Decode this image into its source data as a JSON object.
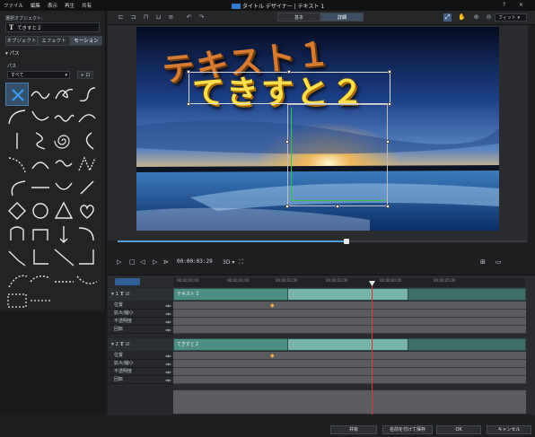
{
  "menu": [
    "ファイル",
    "編集",
    "表示",
    "再生",
    "共有"
  ],
  "app_title": "タイトル デザイナー",
  "doc_title": "テキスト 1",
  "window_controls": [
    "?",
    "×"
  ],
  "left": {
    "selected_object_label": "選択オブジェクト:",
    "selected_object_value": "てきすと２",
    "tabs": [
      "オブジェクト",
      "エフェクト",
      "モーション"
    ],
    "active_tab": "モーション",
    "section": "パス",
    "path_label": "パス",
    "path_select": "すべて",
    "path_add": "+ ロ"
  },
  "mode_tabs": [
    "基本",
    "詳細"
  ],
  "active_mode": "詳細",
  "zoom": "フィット",
  "canvas": {
    "title1": "テキスト１",
    "title2": "てきすと２"
  },
  "transport": {
    "timecode": "00:00:03:29",
    "mode": "3D ▾"
  },
  "ruler_ticks": [
    "00;00;00;00",
    "00;00;01;00",
    "00;00;02;00",
    "00;00;03;00",
    "00;00;04;00",
    "00;00;05;00"
  ],
  "tracks": [
    {
      "index": "1",
      "clip": "テキスト 1",
      "rows": [
        "位置",
        "拡大/縮小",
        "不透明度",
        "回転"
      ]
    },
    {
      "index": "2",
      "clip": "てきすと２",
      "rows": [
        "位置",
        "拡大/縮小",
        "不透明度",
        "回転"
      ]
    }
  ],
  "footer": {
    "share": "共有",
    "save_as": "名前を付けて保存",
    "ok": "OK",
    "cancel": "キャンセル"
  }
}
